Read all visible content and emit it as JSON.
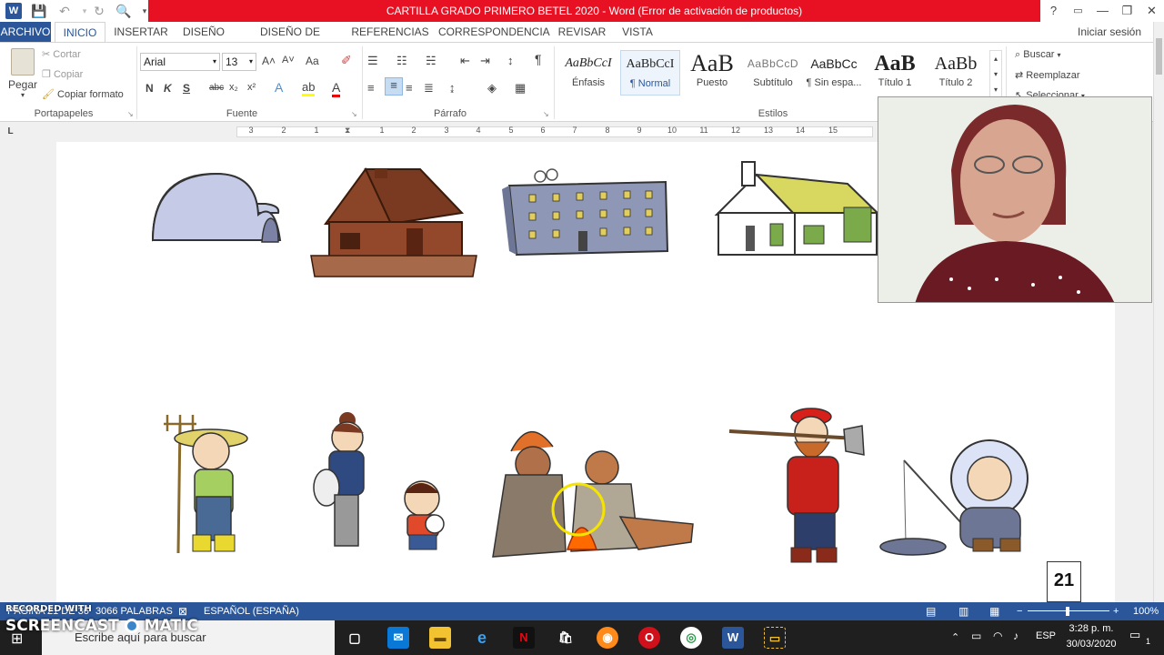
{
  "titlebar": {
    "title": "CARTILLA GRADO PRIMERO BETEL 2020 -  Word (Error de activación de productos)",
    "help": "?",
    "minimize": "—",
    "restore": "❐",
    "close": "✕"
  },
  "tabs": [
    {
      "label": "ARCHIVO"
    },
    {
      "label": "INICIO"
    },
    {
      "label": "INSERTAR"
    },
    {
      "label": "DISEÑO"
    },
    {
      "label": "DISEÑO DE PÁGINA"
    },
    {
      "label": "REFERENCIAS"
    },
    {
      "label": "CORRESPONDENCIA"
    },
    {
      "label": "REVISAR"
    },
    {
      "label": "VISTA"
    }
  ],
  "signin": "Iniciar sesión",
  "clipboard": {
    "paste": "Pegar",
    "cut": "Cortar",
    "copy": "Copiar",
    "format_painter": "Copiar formato",
    "group": "Portapapeles"
  },
  "font": {
    "name": "Arial",
    "size": "13",
    "bold": "N",
    "italic": "K",
    "underline": "S",
    "strike": "abc",
    "subscript": "x₂",
    "superscript": "x²",
    "grow": "A˄",
    "shrink": "A˅",
    "case": "Aa",
    "group": "Fuente"
  },
  "paragraph": {
    "group": "Párrafo",
    "pilcrow": "¶"
  },
  "styles": {
    "group": "Estilos",
    "items": [
      {
        "preview": "AaBbCcI",
        "name": "Énfasis"
      },
      {
        "preview": "AaBbCcI",
        "name": "¶ Normal"
      },
      {
        "preview": "AaB",
        "name": "Puesto"
      },
      {
        "preview": "AaBbCcD",
        "name": "Subtítulo"
      },
      {
        "preview": "AaBbCc",
        "name": "¶ Sin espa..."
      },
      {
        "preview": "AaB",
        "name": "Título 1"
      },
      {
        "preview": "AaBb",
        "name": "Título 2"
      }
    ]
  },
  "editing": {
    "find": "Buscar",
    "replace": "Reemplazar",
    "select": "Seleccionar"
  },
  "ruler": {
    "corner": "L",
    "numbers": [
      "3",
      "2",
      "1",
      "1",
      "2",
      "3",
      "4",
      "5",
      "6",
      "7",
      "8",
      "9",
      "10",
      "11",
      "12",
      "13",
      "14",
      "15"
    ]
  },
  "page": {
    "number": "21"
  },
  "status": {
    "page": "PÁGINA 21 DE 36",
    "words": "3066 PALABRAS",
    "language": "ESPAÑOL (ESPAÑA)",
    "zoom": "100%"
  },
  "watermark": {
    "recorded": "RECORDED WITH",
    "brand_left": "SCREENCAST",
    "brand_right": "MATIC"
  },
  "taskbar": {
    "search_placeholder": "Escribe aquí para buscar",
    "lang": "ESP",
    "time": "3:28 p. m.",
    "date": "30/03/2020",
    "notifications": "1"
  },
  "colors": {
    "word_blue": "#2b579a",
    "title_red": "#e81123",
    "taskbar": "#1f1f1f"
  }
}
